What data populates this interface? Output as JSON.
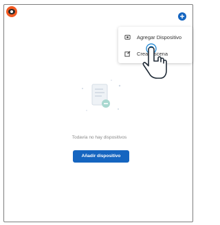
{
  "header": {
    "add_icon": "plus-icon",
    "logo_icon": "eye-logo-icon"
  },
  "menu": {
    "items": [
      {
        "label": "Agregar Dispositivo",
        "icon": "device-icon"
      },
      {
        "label": "Crear escena",
        "icon": "edit-icon"
      }
    ]
  },
  "empty_state": {
    "message": "Todavía no hay dispositivos",
    "button_label": "Añadir dispositivo"
  },
  "colors": {
    "accent": "#1565c0",
    "logo": "#f25a22"
  }
}
